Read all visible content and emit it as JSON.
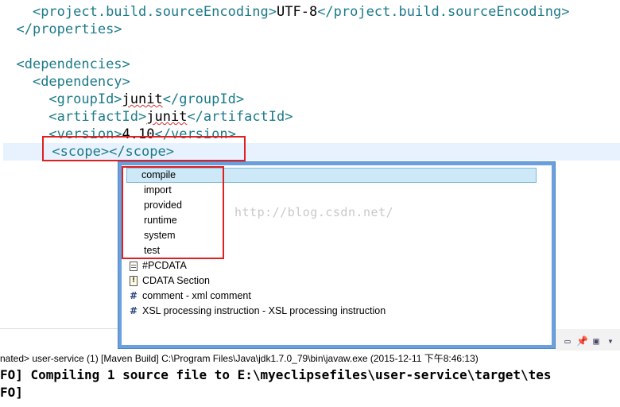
{
  "editor": {
    "lines": [
      {
        "indent": "    ",
        "open": "<project.build.sourceEncoding>",
        "text": "UTF-8",
        "close": "</project.build.sourceEncoding>"
      },
      {
        "indent": "  ",
        "open": "",
        "text": "",
        "close": "</properties>"
      },
      {
        "indent": "",
        "open": "",
        "text": "",
        "close": ""
      },
      {
        "indent": "  ",
        "open": "<dependencies>",
        "text": "",
        "close": ""
      },
      {
        "indent": "    ",
        "open": "<dependency>",
        "text": "",
        "close": ""
      },
      {
        "indent": "      ",
        "open": "<groupId>",
        "text": "junit",
        "close": "</groupId>"
      },
      {
        "indent": "      ",
        "open": "<artifactId>",
        "text": "junit",
        "close": "</artifactId>"
      },
      {
        "indent": "      ",
        "open": "<version>",
        "text": "4.10",
        "close": "</version>"
      },
      {
        "indent": "      ",
        "open": "<scope>",
        "text": "",
        "close": "</scope>"
      }
    ]
  },
  "content_assist": {
    "items": [
      {
        "label": "compile",
        "icon": "none",
        "selected": true
      },
      {
        "label": "import",
        "icon": "none"
      },
      {
        "label": "provided",
        "icon": "none"
      },
      {
        "label": "runtime",
        "icon": "none"
      },
      {
        "label": "system",
        "icon": "none"
      },
      {
        "label": "test",
        "icon": "none"
      },
      {
        "label": "#PCDATA",
        "icon": "pcdata-doc-icon"
      },
      {
        "label": "CDATA Section",
        "icon": "cdata-icon"
      },
      {
        "label": "comment - xml comment",
        "icon": "hash-icon"
      },
      {
        "label": "XSL processing instruction - XSL processing instruction",
        "icon": "hash-icon"
      }
    ]
  },
  "watermark": "http://blog.csdn.net/",
  "console": {
    "header": "nated> user-service (1) [Maven Build] C:\\Program Files\\Java\\jdk1.7.0_79\\bin\\javaw.exe (2015-12-11 下午8:46:13)",
    "lines": [
      "FO] Compiling 1 source file to E:\\myeclipsefiles\\user-service\\target\\tes",
      "FO]"
    ]
  },
  "colors": {
    "tag": "#1c7a8a",
    "highlight_box": "#e02020",
    "popup_border": "#6aa0dc",
    "selection": "#cde8f7"
  }
}
